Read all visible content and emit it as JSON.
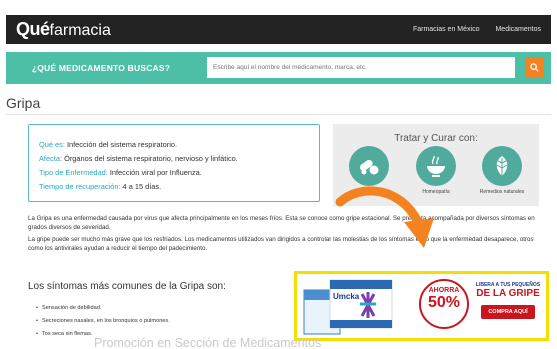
{
  "header": {
    "logo_bold": "Qué",
    "logo_rest": "farmacia",
    "nav": [
      "Farmacias en México",
      "Medicamentos"
    ]
  },
  "search": {
    "question": "¿QUÉ MEDICAMENTO BUSCAS?",
    "placeholder": "Escribe aquí el nombre del medicamento, marca, etc.",
    "button_icon": "search-icon"
  },
  "page_title": "Gripa",
  "info": {
    "que_es_label": "Qué es:",
    "que_es_value": "Infección del sistema respiratorio.",
    "afecta_label": "Afecta:",
    "afecta_value": "Órganos del sistema respiratorio, nervioso y linfático.",
    "tipo_label": "Tipo de Enfermedad:",
    "tipo_value": "Infección viral por Influenza.",
    "tiempo_label": "Tiempo de recuperación:",
    "tiempo_value": "4 a 15 días."
  },
  "treat": {
    "title": "Tratar y Curar con:",
    "items": [
      {
        "label": "Medicamentos",
        "icon": "pills-icon"
      },
      {
        "label": "Homeopatía",
        "icon": "bowl-icon"
      },
      {
        "label": "Remedios naturales",
        "icon": "leaf-icon"
      }
    ]
  },
  "paragraphs": [
    "La Gripa es una enfermedad causada por virus que afecta principalmente en los meses fríos. Esta se conoce como gripe estacional. Se presenta acompañada por diversos síntomas en grados diversos de severidad.",
    "La gripe puede ser mucho más grave que los resfriados. Los medicamentos utilizados van dirigidos a controlar las molestias de los síntomas en lo que la enfermedad desaparece, otros como los antivirales ayudan a reducir el tiempo del padecimiento."
  ],
  "symptoms": {
    "heading": "Los síntomas más comunes de la Gripa son:",
    "items": [
      "Sensación de debilidad.",
      "Secreciones nasales, en los bronquios o pulmones.",
      "Tos seca sin flemas."
    ]
  },
  "promo": {
    "brand": "Umcka",
    "ahorra": "AHORRA",
    "discount": "50%",
    "line1": "LIBERA A TUS PEQUEÑOS",
    "line2": "DE LA GRIPE",
    "button": "COMPRA AQUÍ",
    "caption": "Promoción en Sección de Medicamentos"
  },
  "colors": {
    "teal": "#4dbfa6",
    "orange": "#f58220",
    "link_blue": "#2aa6c7",
    "promo_border": "#f3e000",
    "promo_red": "#c9151e"
  }
}
